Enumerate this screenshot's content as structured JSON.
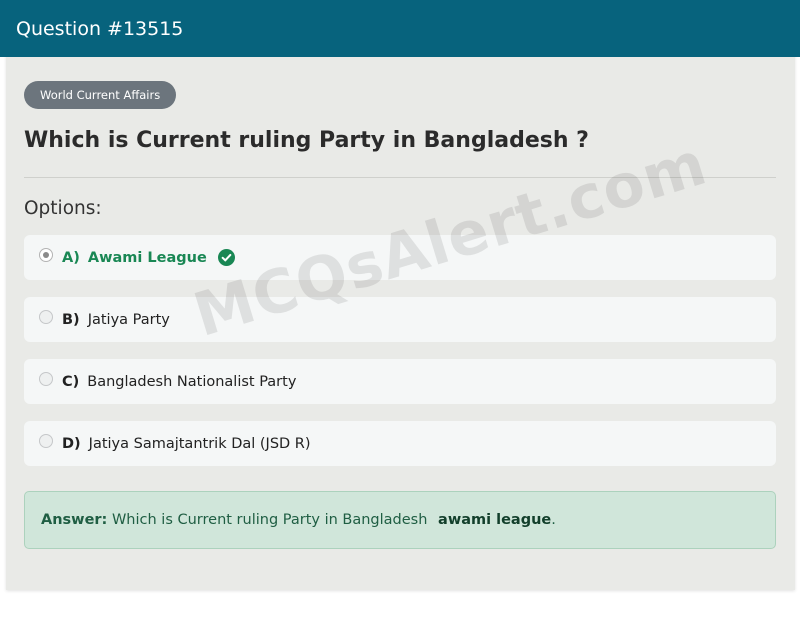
{
  "header": {
    "title": "Question #13515"
  },
  "category_badge": "World Current Affairs",
  "question": "Which is Current ruling Party in Bangladesh ?",
  "options_heading": "Options:",
  "options": [
    {
      "letter": "A)",
      "text": "Awami League",
      "selected": true,
      "correct": true
    },
    {
      "letter": "B)",
      "text": "Jatiya Party",
      "selected": false,
      "correct": false
    },
    {
      "letter": "C)",
      "text": "Bangladesh Nationalist Party",
      "selected": false,
      "correct": false
    },
    {
      "letter": "D)",
      "text": "Jatiya Samajtantrik Dal (JSD R)",
      "selected": false,
      "correct": false
    }
  ],
  "answer": {
    "label": "Answer:",
    "text": "Which is Current ruling Party in Bangladesh",
    "highlight": "awami league",
    "suffix": "."
  },
  "watermark": "MCQsAlert.com",
  "colors": {
    "header_bg": "#07637d",
    "correct": "#198754",
    "answer_bg": "#d0e6da",
    "badge_bg": "#6c757d"
  },
  "icons": {
    "correct_mark": "check-circle-icon"
  }
}
